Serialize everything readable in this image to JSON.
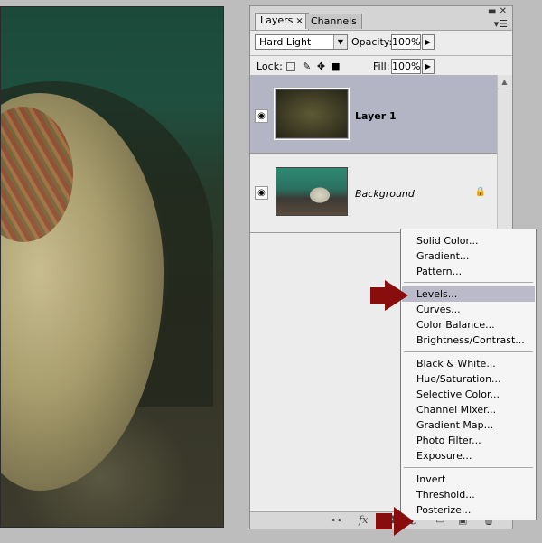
{
  "panel": {
    "tabs": [
      {
        "label": "Layers",
        "close": "×"
      },
      {
        "label": "Channels"
      }
    ],
    "window_controls": {
      "minimize": "▬",
      "close": "✕",
      "menu": "▾☰"
    },
    "blend_mode": "Hard Light",
    "opacity_label": "Opacity:",
    "opacity_value": "100%",
    "lock_label": "Lock:",
    "fill_label": "Fill:",
    "fill_value": "100%",
    "lock_icons": [
      "transparent-pixels-lock-icon",
      "brush-lock-icon",
      "move-lock-icon",
      "padlock-icon"
    ],
    "layers": [
      {
        "name": "Layer 1",
        "selected": true
      },
      {
        "name": "Background",
        "selected": false,
        "locked": true
      }
    ],
    "bottom_icons": [
      "link-icon",
      "fx-icon",
      "mask-icon",
      "adjustment-layer-icon",
      "group-folder-icon",
      "new-layer-icon",
      "trash-icon"
    ]
  },
  "menu": {
    "groups": [
      [
        "Solid Color...",
        "Gradient...",
        "Pattern..."
      ],
      [
        "Levels...",
        "Curves...",
        "Color Balance...",
        "Brightness/Contrast..."
      ],
      [
        "Black & White...",
        "Hue/Saturation...",
        "Selective Color...",
        "Channel Mixer...",
        "Gradient Map...",
        "Photo Filter...",
        "Exposure..."
      ],
      [
        "Invert",
        "Threshold...",
        "Posterize..."
      ]
    ],
    "highlighted": "Levels..."
  },
  "colors": {
    "selection": "#b3b5c5",
    "menu_highlight": "#babacb",
    "arrow": "#8a0d0d"
  }
}
